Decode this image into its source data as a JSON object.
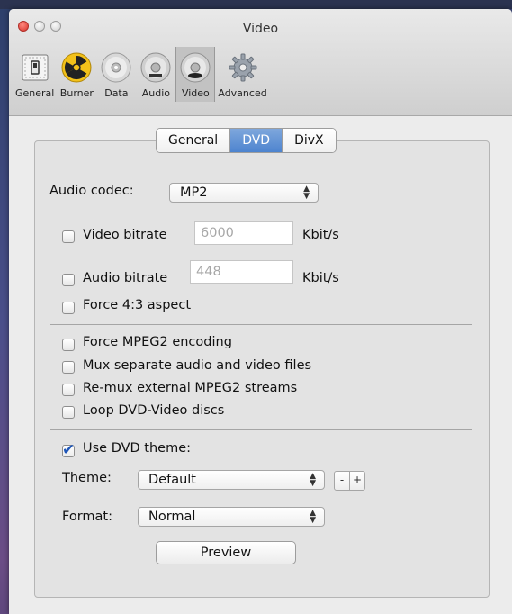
{
  "window": {
    "title": "Video"
  },
  "toolbar": {
    "items": [
      {
        "label": "General",
        "icon": "switch-icon"
      },
      {
        "label": "Burner",
        "icon": "radiation-icon"
      },
      {
        "label": "Data",
        "icon": "disc-icon"
      },
      {
        "label": "Audio",
        "icon": "audio-disc-icon"
      },
      {
        "label": "Video",
        "icon": "dvd-disc-icon",
        "selected": true
      },
      {
        "label": "Advanced",
        "icon": "gear-icon"
      }
    ]
  },
  "tabs": [
    {
      "label": "General"
    },
    {
      "label": "DVD",
      "active": true
    },
    {
      "label": "DivX"
    }
  ],
  "dvd": {
    "audio_codec_label": "Audio codec:",
    "audio_codec_value": "MP2",
    "video_bitrate": {
      "label": "Video bitrate",
      "checked": false,
      "placeholder": "6000",
      "unit": "Kbit/s"
    },
    "audio_bitrate": {
      "label": "Audio bitrate",
      "checked": false,
      "placeholder": "448",
      "unit": "Kbit/s"
    },
    "force_aspect": {
      "label": "Force 4:3 aspect",
      "checked": false
    },
    "force_mpeg2": {
      "label": "Force MPEG2 encoding",
      "checked": false
    },
    "mux_separate": {
      "label": "Mux separate audio and video files",
      "checked": false
    },
    "remux_external": {
      "label": "Re-mux external MPEG2 streams",
      "checked": false
    },
    "loop_discs": {
      "label": "Loop DVD-Video discs",
      "checked": false
    },
    "use_theme": {
      "label": "Use DVD theme:",
      "checked": true
    },
    "theme_label": "Theme:",
    "theme_value": "Default",
    "theme_minus": "-",
    "theme_plus": "+",
    "format_label": "Format:",
    "format_value": "Normal",
    "preview_label": "Preview"
  },
  "colors": {
    "accent": "#4d84cf",
    "close": "#d8322a",
    "check": "#1e56b8"
  }
}
